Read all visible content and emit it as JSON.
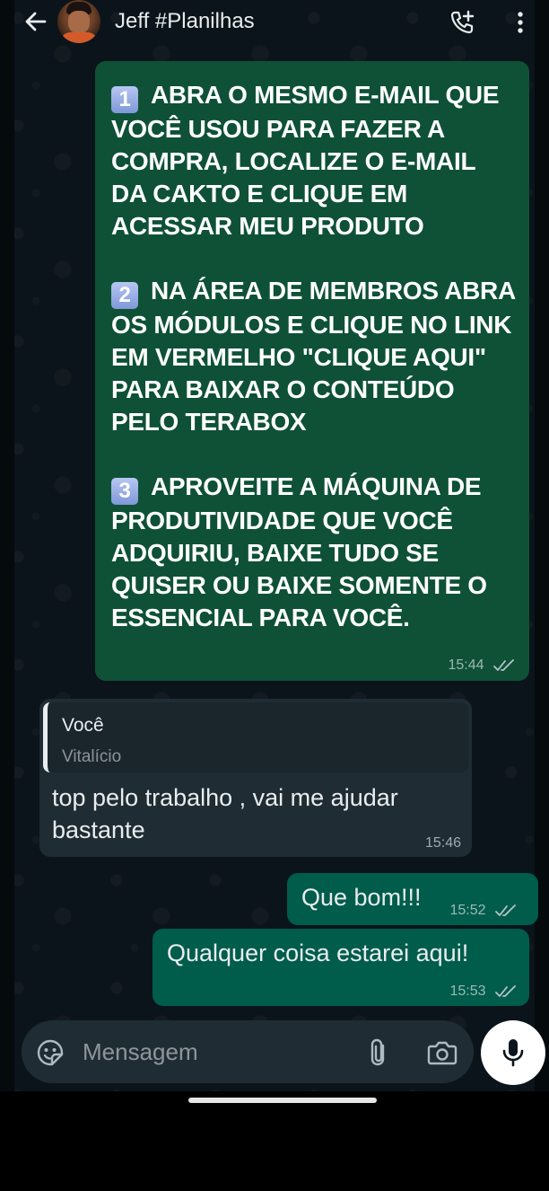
{
  "header": {
    "contact_name": "Jeff #Planilhas",
    "icons": [
      "back-arrow-icon",
      "avatar",
      "add-call-icon",
      "more-vertical-icon"
    ]
  },
  "messages": [
    {
      "direction": "out",
      "paragraphs": [
        {
          "number": "1",
          "text": "ABRA O MESMO E-MAIL QUE VOCÊ USOU PARA FAZER A COMPRA, LOCALIZE O E-MAIL DA CAKTO E CLIQUE EM ACESSAR MEU PRODUTO"
        },
        {
          "number": "2",
          "text": "NA ÁREA DE MEMBROS ABRA OS MÓDULOS E CLIQUE NO LINK EM VERMELHO \"CLIQUE AQUI\" PARA BAIXAR O CONTEÚDO PELO TERABOX"
        },
        {
          "number": "3",
          "text": "APROVEITE A MÁQUINA DE PRODUTIVIDADE QUE VOCÊ ADQUIRIU, BAIXE TUDO SE QUISER OU BAIXE SOMENTE O ESSENCIAL PARA VOCÊ."
        }
      ],
      "time": "15:44",
      "status": "read"
    },
    {
      "direction": "in",
      "quote": {
        "author": "Você",
        "text": "Vitalício"
      },
      "text": "top pelo trabalho , vai me ajudar bastante",
      "time": "15:46"
    },
    {
      "direction": "out",
      "text": "Que bom!!!",
      "time": "15:52",
      "status": "read"
    },
    {
      "direction": "out",
      "text": "Qualquer coisa estarei aqui!",
      "time": "15:53",
      "status": "read"
    }
  ],
  "composer": {
    "placeholder": "Mensagem",
    "icons": [
      "emoji-sticker-icon",
      "paperclip-icon",
      "camera-icon",
      "microphone-icon"
    ]
  },
  "colors": {
    "chat_background": "#0b141a",
    "outgoing_bubble": "#005c4b",
    "incoming_bubble": "#1f2c34",
    "read_ticks": "#b5c4c9"
  }
}
